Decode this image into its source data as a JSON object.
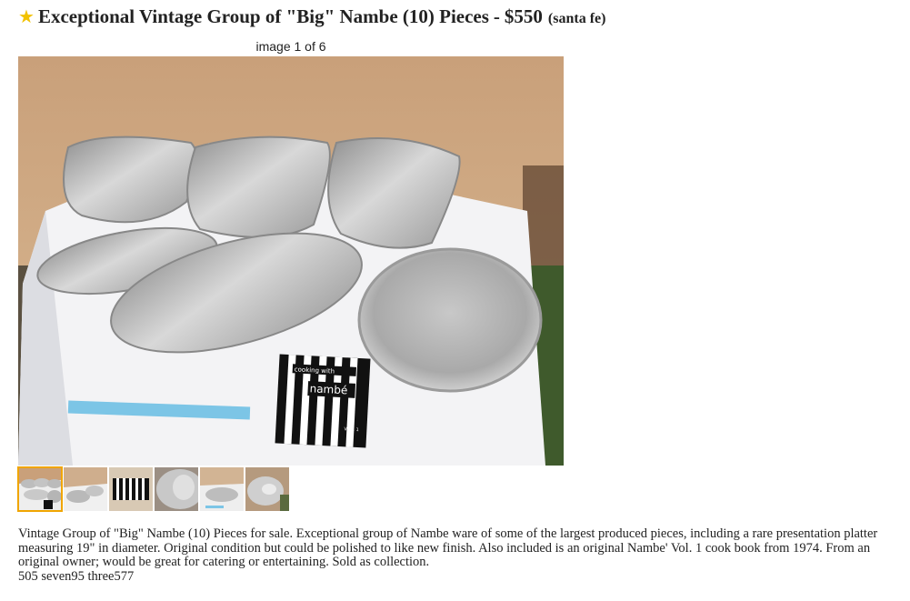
{
  "posting": {
    "title": "Exceptional Vintage Group of \"Big\" Nambe (10) Pieces",
    "price_separator": "-",
    "price": "$550",
    "location": "(santa fe)",
    "star_glyph": "★",
    "star_color": "#f2c200"
  },
  "gallery": {
    "counter": "image 1 of 6",
    "selected_index": 0,
    "selected_color": "#f0a500",
    "main_image_book_title": "cooking with",
    "main_image_book_brand": "nambé",
    "main_image_book_volume": "VOL. 1",
    "thumbnails": [
      {
        "name": "thumbnail-1"
      },
      {
        "name": "thumbnail-2"
      },
      {
        "name": "thumbnail-3"
      },
      {
        "name": "thumbnail-4"
      },
      {
        "name": "thumbnail-5"
      },
      {
        "name": "thumbnail-6"
      }
    ]
  },
  "body": {
    "description": "Vintage Group of \"Big\" Nambe (10) Pieces for sale. Exceptional group of Nambe ware of some of the largest produced pieces, including a rare presentation platter measuring 19\" in diameter. Original condition but could be polished to like new finish. Also included is an original Nambe' Vol. 1 cook book from 1974. From an original owner; would be great for catering or entertaining. Sold as collection.",
    "phone": "505 seven95 three577"
  }
}
